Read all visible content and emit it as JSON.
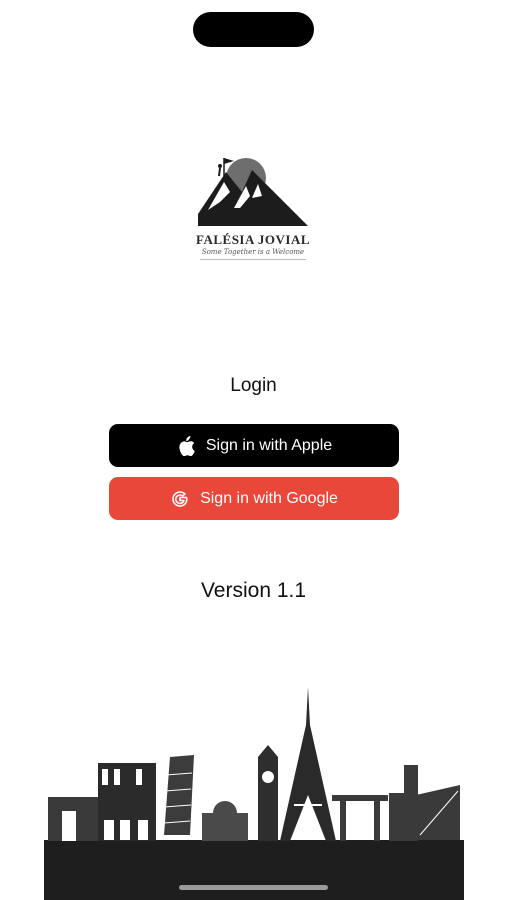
{
  "brand": {
    "name": "FALÉSIA JOVIAL",
    "tagline": "Some Together is a Welcome"
  },
  "login": {
    "title": "Login",
    "apple_label": "Sign in with Apple",
    "google_label": "Sign in with Google"
  },
  "footer": {
    "version": "Version 1.1"
  },
  "icons": {
    "apple": "apple-logo-icon",
    "google": "google-g-icon"
  },
  "colors": {
    "apple_button": "#000000",
    "google_button": "#e9473a",
    "background": "#ffffff"
  }
}
